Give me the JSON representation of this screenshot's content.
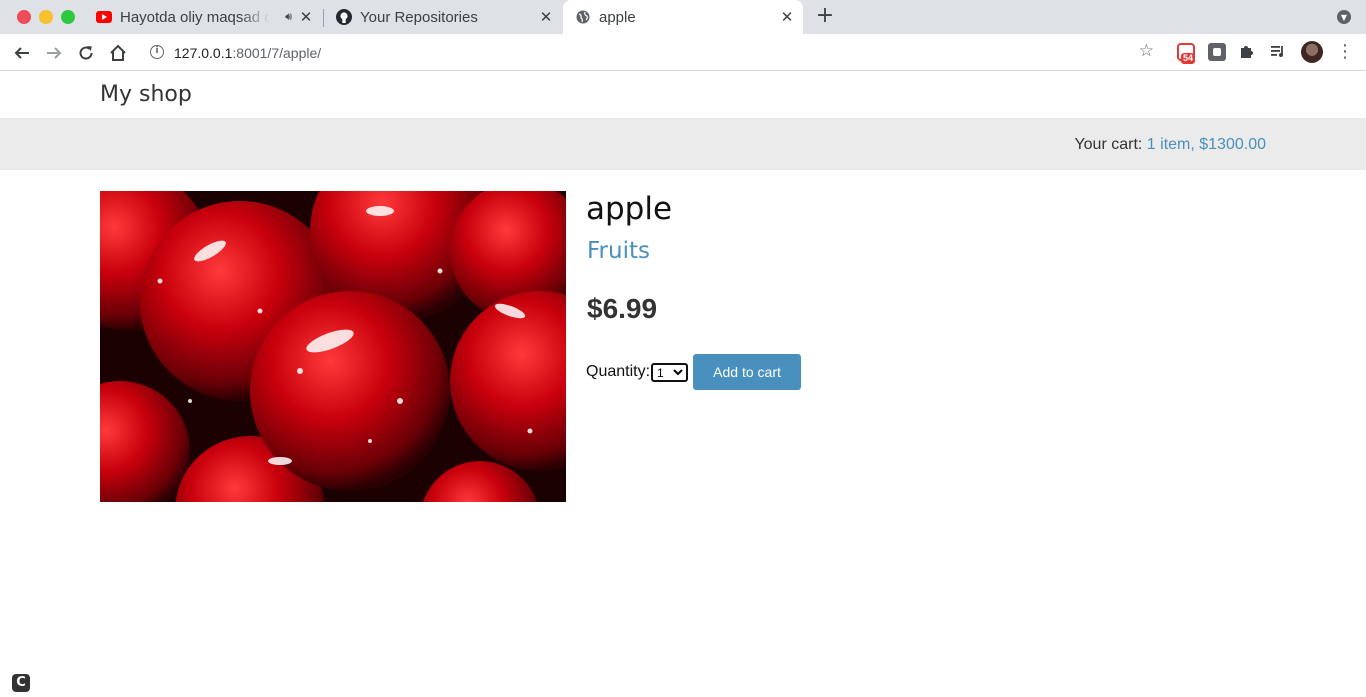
{
  "browser": {
    "tabs": [
      {
        "title": "Hayotda oliy maqsad o",
        "favicon": "youtube-icon",
        "audio": true,
        "active": false
      },
      {
        "title": "Your Repositories",
        "favicon": "github-icon",
        "active": false
      },
      {
        "title": "apple",
        "favicon": "globe-icon",
        "active": true
      }
    ],
    "address": {
      "host": "127.0.0.1",
      "rest": ":8001/7/apple/"
    },
    "extensions": {
      "badge_count": "54"
    },
    "colors": {
      "accent_red": "#e53935"
    }
  },
  "site": {
    "title": "My shop",
    "cart": {
      "label": "Your cart:",
      "link_text": "1 item, $1300.00"
    }
  },
  "product": {
    "name": "apple",
    "category": "Fruits",
    "price": "$6.99",
    "image_subject": "red cherries with water droplets",
    "quantity_label": "Quantity:",
    "quantity_selected": "1",
    "add_button_label": "Add to cart"
  },
  "theme": {
    "link_color": "#4a90be",
    "header_bg": "#ebebeb"
  },
  "footer": {
    "corner_icon_letter": "C"
  }
}
